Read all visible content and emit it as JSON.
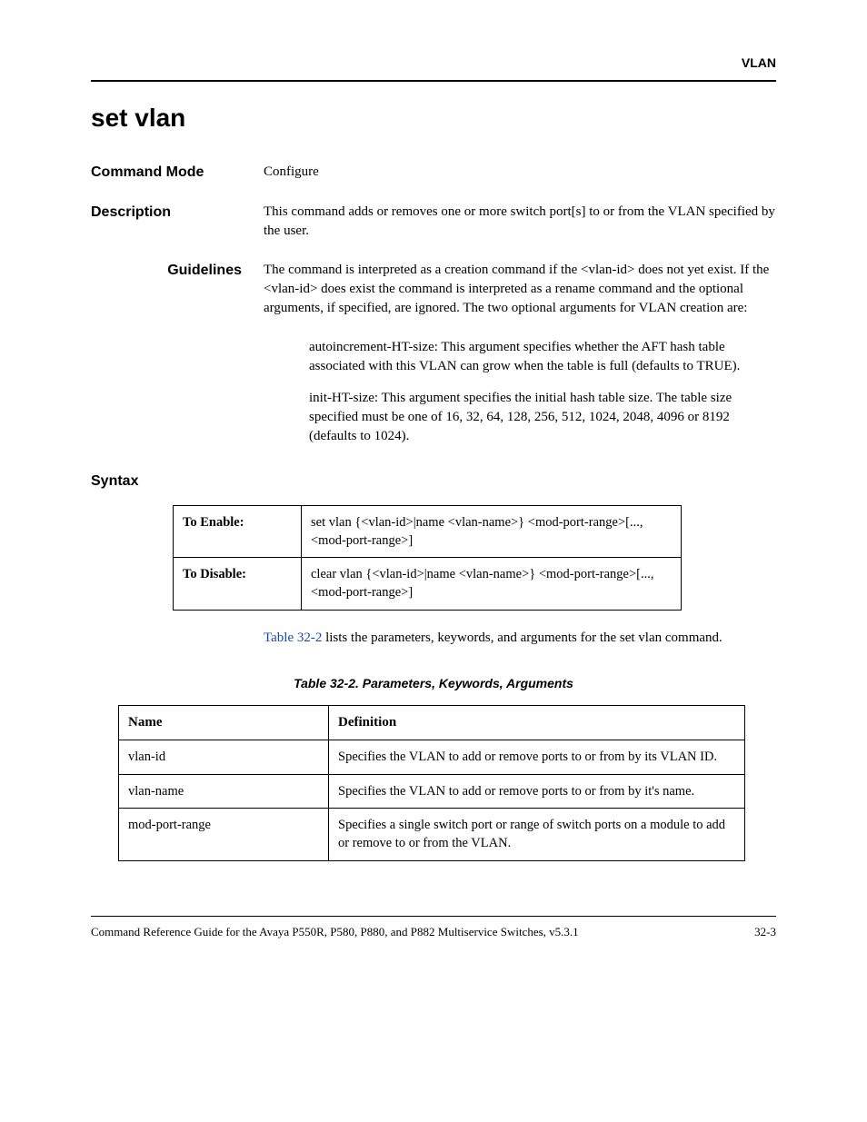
{
  "header": {
    "section": "VLAN"
  },
  "title": "set vlan",
  "fields": {
    "command_mode_label": "Command Mode",
    "command_mode_value": "Configure",
    "description_label": "Description",
    "description_value": "This command adds or removes one or more switch port[s] to or from the VLAN specified by the user.",
    "guidelines_label": "Guidelines",
    "guidelines_value": "The command is interpreted as a creation command if the <vlan-id> does not yet exist. If the <vlan-id> does exist the command is interpreted as a rename command and the optional arguments, if specified, are ignored. The two optional arguments for VLAN creation are:",
    "guidelines_para1": "autoincrement-HT-size: This argument specifies whether the AFT hash table associated with this VLAN can grow when the table is full (defaults to TRUE).",
    "guidelines_para2": "init-HT-size: This argument specifies the initial hash table size. The table size specified must be one of 16, 32, 64, 128, 256, 512, 1024, 2048, 4096 or 8192 (defaults to 1024).",
    "syntax_label": "Syntax"
  },
  "syntax_table": {
    "enable_label": "To Enable:",
    "enable_value": "set vlan {<vlan-id>|name <vlan-name>} <mod-port-range>[...,<mod-port-range>]",
    "disable_label": "To Disable:",
    "disable_value": "clear vlan {<vlan-id>|name <vlan-name>} <mod-port-range>[...,<mod-port-range>]"
  },
  "note": {
    "link_text": "Table 32-2",
    "rest_text": " lists the parameters, keywords, and arguments for the set vlan command."
  },
  "param_table": {
    "caption": "Table 32-2.  Parameters, Keywords, Arguments",
    "headers": {
      "name": "Name",
      "definition": "Definition"
    },
    "rows": [
      {
        "name": "vlan-id",
        "def": "Specifies the VLAN to add or remove ports to or from by its VLAN ID."
      },
      {
        "name": "vlan-name",
        "def": "Specifies the VLAN to add or remove ports to or from by it's name."
      },
      {
        "name": "mod-port-range",
        "def": "Specifies a single switch port or range of switch ports on a module to add or remove to or from the VLAN."
      }
    ]
  },
  "footer": {
    "title": "Command Reference Guide for the Avaya P550R, P580, P880, and P882 Multiservice Switches, v5.3.1",
    "page": "32-3"
  }
}
